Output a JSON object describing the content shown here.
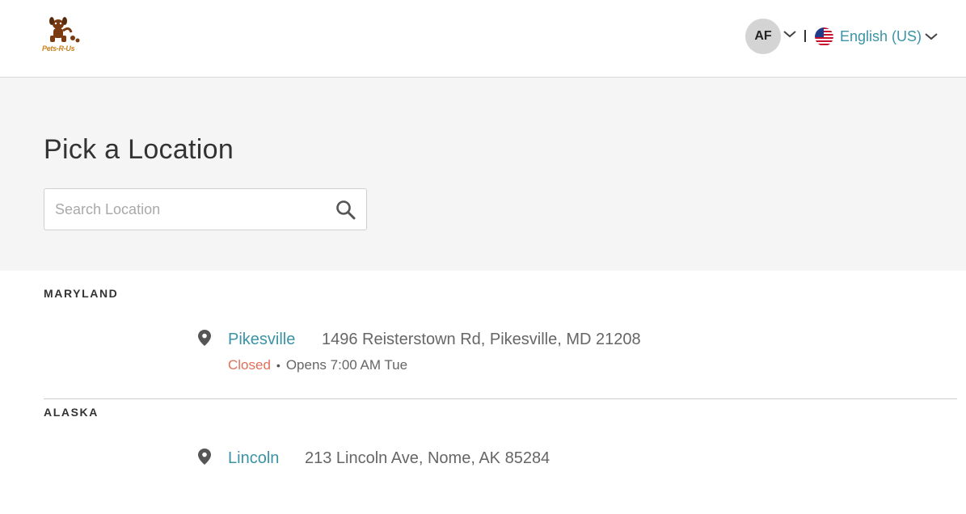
{
  "header": {
    "logo_text": "Pets-R-Us",
    "user_initials": "AF",
    "language": "English (US)"
  },
  "hero": {
    "title": "Pick a Location",
    "search_placeholder": "Search Location"
  },
  "regions": [
    {
      "name": "MARYLAND",
      "locations": [
        {
          "name": "Pikesville",
          "address": "1496 Reisterstown Rd, Pikesville, MD 21208",
          "status": "Closed",
          "hours": "Opens 7:00 AM Tue"
        }
      ]
    },
    {
      "name": "ALASKA",
      "locations": [
        {
          "name": "Lincoln",
          "address": "213 Lincoln Ave, Nome, AK 85284"
        }
      ]
    }
  ],
  "colors": {
    "accent": "#3a93a6",
    "closed": "#e0705a",
    "hero_bg": "#f5f5f5",
    "brand_brown": "#7a3b12"
  }
}
